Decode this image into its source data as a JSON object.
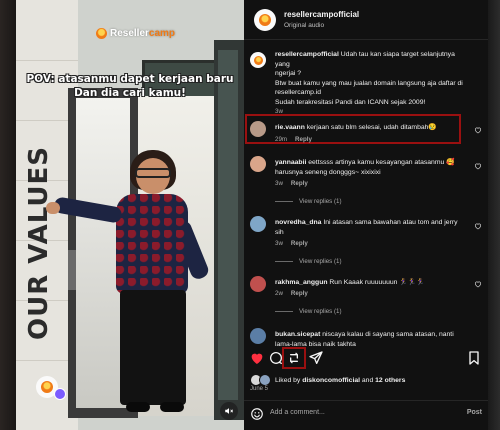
{
  "media": {
    "brand_logo_prefix": "Reseller",
    "brand_logo_suffix": "camp",
    "caption_line1": "POV: atasanmu dapet kerjaan baru",
    "caption_line2": "Dan dia cari kamu!",
    "wall_text": "OUR VALUES"
  },
  "header": {
    "username": "resellercampofficial",
    "subtitle": "Original audio"
  },
  "post_caption": {
    "username": "resellercampofficial",
    "line1": "Udah tau kan siapa target selanjutnya yang",
    "line2": "ngerjai ?",
    "line3": "Btw buat kamu yang mau jualan domain langsung aja daftar di",
    "line4": "resellercamp.id",
    "line5": "Sudah terakresitasi Pandi dan ICANN sejak 2009!",
    "time": "3w"
  },
  "comments": [
    {
      "username": "rie.vaann",
      "text": "kerjaan satu blm selesai, udah ditambah😢",
      "time": "29m",
      "reply": "Reply",
      "avatar_color": "#b89a88"
    },
    {
      "username": "yannaabii",
      "text_line1": "eettssss artinya kamu kesayangan atasanmu 🥰",
      "text_line2": "harusnya seneng dongggs~ xixixixi",
      "time": "3w",
      "reply": "Reply",
      "view_replies": "View replies (1)",
      "avatar_color": "#d9a58a"
    },
    {
      "username": "novredha_dna",
      "text_line1": "Ini atasan sama bawahan atau tom and jerry",
      "text_line2": "sih",
      "time": "3w",
      "reply": "Reply",
      "view_replies": "View replies (1)",
      "avatar_color": "#7fa6c7"
    },
    {
      "username": "rakhma_anggun",
      "text": "Run Kaaak ruuuuuuun 🏃‍♀️🏃‍♀️🏃‍♀️",
      "time": "2w",
      "reply": "Reply",
      "view_replies": "View replies (1)",
      "avatar_color": "#c0504e"
    },
    {
      "username": "bukan.sicepat",
      "text_line1": "niscaya kalau di sayang sama atasan, nanti",
      "text_line2": "lama-lama bisa naik takhta",
      "avatar_color": "#5b7ea6"
    }
  ],
  "likes": {
    "prefix": "Liked by",
    "user": "diskoncomofficial",
    "connector": "and",
    "others": "12 others"
  },
  "date": "June 5",
  "add_comment": {
    "placeholder": "Add a comment...",
    "post_label": "Post"
  },
  "colors": {
    "liked_heart": "#ff3040",
    "highlight": "#9a1010",
    "brand_orange": "#f07b16"
  }
}
